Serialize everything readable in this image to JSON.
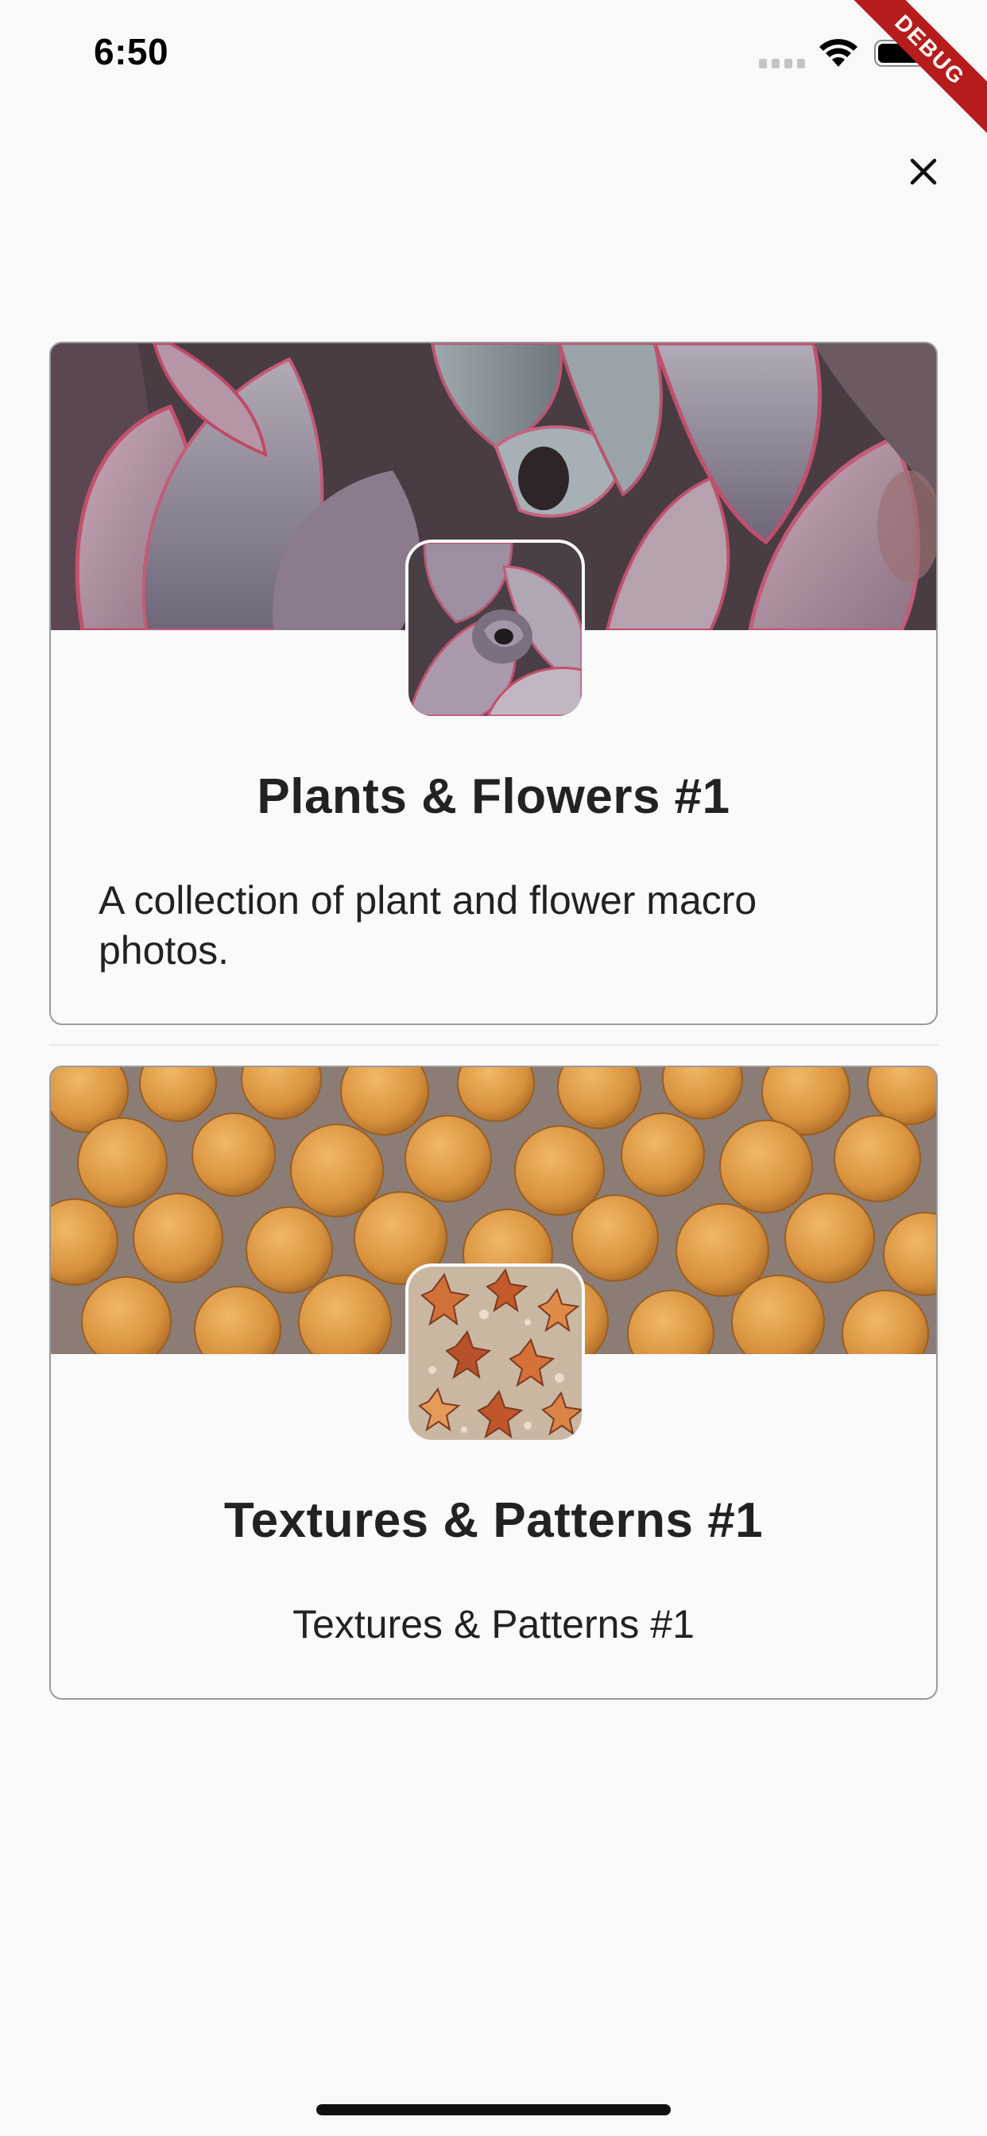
{
  "status_bar": {
    "time": "6:50",
    "signal_icon": "signal-bars-icon",
    "wifi_icon": "wifi-icon",
    "battery_icon": "battery-icon"
  },
  "debug_banner": {
    "label": "DEBUG",
    "color": "#b71c1c"
  },
  "header": {
    "close_icon": "close-icon"
  },
  "cards": [
    {
      "title": "Plants & Flowers #1",
      "description": "A collection of plant and flower macro photos.",
      "banner_image": "succulent-macro-photo",
      "thumbnail_image": "succulent-rosette-photo"
    },
    {
      "title": "Textures & Patterns #1",
      "description": "Textures & Patterns #1",
      "banner_image": "drying-orange-cakes-photo",
      "thumbnail_image": "orange-starfish-pattern-photo"
    }
  ],
  "colors": {
    "background": "#f9f9fa",
    "card_border": "#9a9a9a",
    "text": "#222222"
  }
}
